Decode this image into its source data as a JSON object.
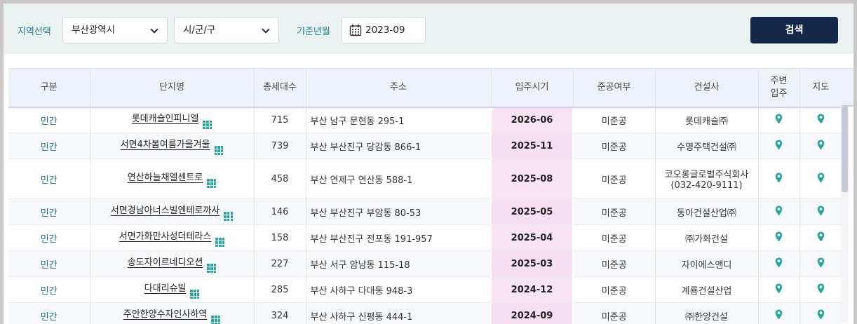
{
  "filters": {
    "region_label": "지역선택",
    "region_value": "부산광역시",
    "district_value": "시/군/구",
    "date_label": "기준년월",
    "date_value": "2023-09",
    "search_label": "검색"
  },
  "table": {
    "headers": {
      "kind": "구분",
      "name": "단지명",
      "units": "총세대수",
      "address": "주소",
      "move_in": "입주시기",
      "completion": "준공여부",
      "builder": "건설사",
      "nearby_line1": "주변",
      "nearby_line2": "입주",
      "map": "지도"
    },
    "rows": [
      {
        "kind": "민간",
        "name": "롯데캐슬인피니엘",
        "units": "715",
        "address": "부산 남구 문현동 295-1",
        "move_in": "2026-06",
        "completion": "미준공",
        "builder": "롯데캐슬㈜",
        "builder_phone": ""
      },
      {
        "kind": "민간",
        "name": "서면4차봄여름가을겨울",
        "units": "739",
        "address": "부산 부산진구 당감동 866-1",
        "move_in": "2025-11",
        "completion": "미준공",
        "builder": "수영주택건설㈜",
        "builder_phone": ""
      },
      {
        "kind": "민간",
        "name": "연산하늘채엘센트로",
        "units": "458",
        "address": "부산 연제구 연산동 588-1",
        "move_in": "2025-08",
        "completion": "미준공",
        "builder": "코오롱글로벌주식회사",
        "builder_phone": "(032-420-9111)"
      },
      {
        "kind": "민간",
        "name": "서면경남아너스빌엔테로까사",
        "units": "146",
        "address": "부산 부산진구 부암동 80-53",
        "move_in": "2025-05",
        "completion": "미준공",
        "builder": "동아건설산업㈜",
        "builder_phone": ""
      },
      {
        "kind": "민간",
        "name": "서면가화만사성더테라스",
        "units": "158",
        "address": "부산 부산진구 전포동 191-957",
        "move_in": "2025-04",
        "completion": "미준공",
        "builder": "㈜가화건설",
        "builder_phone": ""
      },
      {
        "kind": "민간",
        "name": "송도자이르네디오션",
        "units": "227",
        "address": "부산 서구 암남동 115-18",
        "move_in": "2025-03",
        "completion": "미준공",
        "builder": "자이에스앤디",
        "builder_phone": ""
      },
      {
        "kind": "민간",
        "name": "다대리슈빌",
        "units": "285",
        "address": "부산 사하구 다대동 948-3",
        "move_in": "2024-12",
        "completion": "미준공",
        "builder": "계룡건설산업",
        "builder_phone": ""
      },
      {
        "kind": "민간",
        "name": "주안한양수자인사하역",
        "units": "324",
        "address": "부산 사하구 신평동 444-1",
        "move_in": "2024-09",
        "completion": "미준공",
        "builder": "㈜한양건설",
        "builder_phone": ""
      }
    ]
  },
  "colors": {
    "accent_teal": "#2aa6a0",
    "search_button": "#14294a",
    "move_in_highlight": "#f9e4f4"
  },
  "icons": {
    "dropdown": "chevron-down-icon",
    "calendar": "calendar-icon",
    "complex_info": "grid-icon",
    "location": "map-pin-icon"
  }
}
